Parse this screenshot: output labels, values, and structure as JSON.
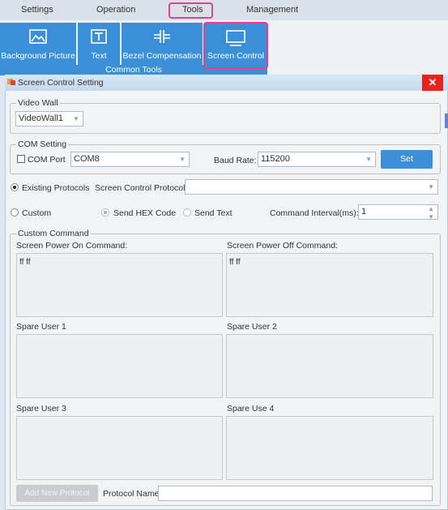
{
  "menu": {
    "items": [
      "Settings",
      "Operation",
      "Tools",
      "Management"
    ]
  },
  "ribbon": {
    "tools": [
      "Background Picture",
      "Text",
      "Bezel Compensation",
      "Screen Control"
    ],
    "group_label": "Common Tools"
  },
  "dialog": {
    "title": "Screen Control Setting",
    "close": "✕",
    "video_wall": {
      "legend": "Video Wall",
      "value": "VideoWall1"
    },
    "com_setting": {
      "legend": "COM Setting",
      "com_port_label": "COM Port",
      "com_port_value": "COM8",
      "baud_rate_label": "Baud Rate:",
      "baud_rate_value": "115200",
      "set_button": "Set"
    },
    "existing_protocols_label": "Existing Protocols",
    "screen_control_protocol_label": "Screen Control Protocol:",
    "screen_control_protocol_value": "",
    "custom_label": "Custom",
    "send_hex_label": "Send HEX Code",
    "send_text_label": "Send Text",
    "command_interval_label": "Command Interval(ms):",
    "command_interval_value": "1",
    "custom_command": {
      "legend": "Custom Command",
      "power_on_label": "Screen Power On Command:",
      "power_on_value": "ff ff",
      "power_off_label": "Screen Power Off Command:",
      "power_off_value": "ff ff",
      "spare1_label": "Spare User 1",
      "spare2_label": "Spare User 2",
      "spare3_label": "Spare User 3",
      "spare4_label": "Spare Use 4"
    },
    "add_protocol_button": "Add New Protocol",
    "protocol_name_label": "Protocol Name:",
    "protocol_name_value": ""
  }
}
